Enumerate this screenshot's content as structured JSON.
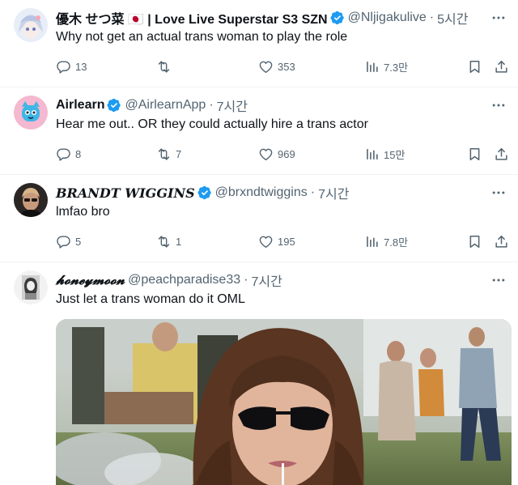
{
  "tweets": [
    {
      "name": "優木 せつ菜 🇯🇵 | Love Live Superstar S3 SZN",
      "handle": "@Nljigakulive",
      "time": "5시간",
      "text": "Why not get an actual trans woman to play the role",
      "replies": "13",
      "retweets": "",
      "likes": "353",
      "views": "7.3만"
    },
    {
      "name": "Airlearn",
      "handle": "@AirlearnApp",
      "time": "7시간",
      "text": "Hear me out.. OR they could actually hire a trans actor",
      "replies": "8",
      "retweets": "7",
      "likes": "969",
      "views": "15만"
    },
    {
      "name": "BRANDT WIGGINS",
      "handle": "@brxndtwiggins",
      "time": "7시간",
      "text": "lmfao bro",
      "replies": "5",
      "retweets": "1",
      "likes": "195",
      "views": "7.8만"
    },
    {
      "name": "𝓱𝓸𝓷𝓮𝔂𝓶𝓸𝓸𝓷",
      "handle": "@peachparadise33",
      "time": "7시간",
      "text": "Just let a trans woman do it OML"
    }
  ],
  "separator": "·",
  "icons": {
    "reply": "reply-icon",
    "retweet": "retweet-icon",
    "like": "heart-icon",
    "views": "views-icon",
    "bookmark": "bookmark-icon",
    "share": "share-icon",
    "more": "more-icon",
    "verified": "verified-badge-icon"
  },
  "colors": {
    "text": "#0f1419",
    "secondary": "#536471",
    "verified": "#1d9bf0",
    "divider": "#eff3f4"
  }
}
